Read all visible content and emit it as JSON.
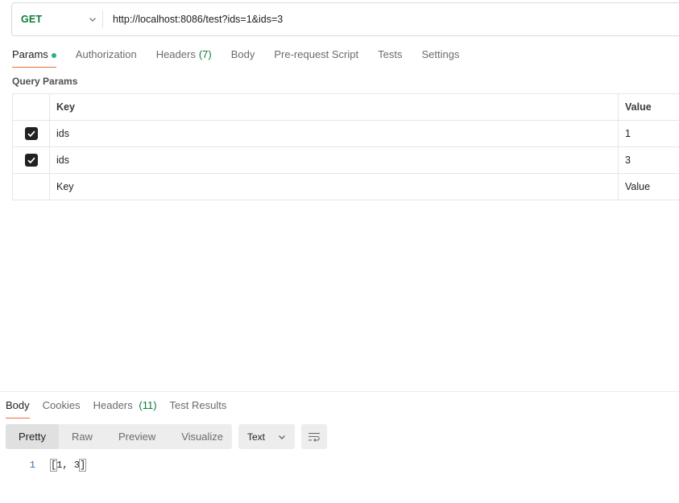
{
  "request": {
    "method": "GET",
    "url": "http://localhost:8086/test?ids=1&ids=3"
  },
  "request_tabs": {
    "params": "Params",
    "authorization": "Authorization",
    "headers": "Headers",
    "headers_count": "(7)",
    "body": "Body",
    "pre_request": "Pre-request Script",
    "tests": "Tests",
    "settings": "Settings"
  },
  "query_params": {
    "title": "Query Params",
    "columns": {
      "key": "Key",
      "value": "Value"
    },
    "rows": [
      {
        "checked": true,
        "key": "ids",
        "value": "1"
      },
      {
        "checked": true,
        "key": "ids",
        "value": "3"
      }
    ],
    "placeholder": {
      "key": "Key",
      "value": "Value"
    }
  },
  "response": {
    "tabs": {
      "body": "Body",
      "cookies": "Cookies",
      "headers": "Headers",
      "headers_count": "(11)",
      "test_results": "Test Results"
    },
    "views": {
      "pretty": "Pretty",
      "raw": "Raw",
      "preview": "Preview",
      "visualize": "Visualize"
    },
    "format": "Text",
    "lines": [
      {
        "number": "1",
        "open": "[",
        "content": "1, 3",
        "close": "]"
      }
    ]
  },
  "colors": {
    "method_green": "#0f7b3a",
    "active_tab_underline": "#f26b3a",
    "params_dot": "#26b47f"
  },
  "icons": {
    "method_dropdown": "chevron-down-icon",
    "checkbox": "checkmark-icon",
    "format_dropdown": "chevron-down-icon",
    "wrap": "wrap-lines-icon"
  }
}
